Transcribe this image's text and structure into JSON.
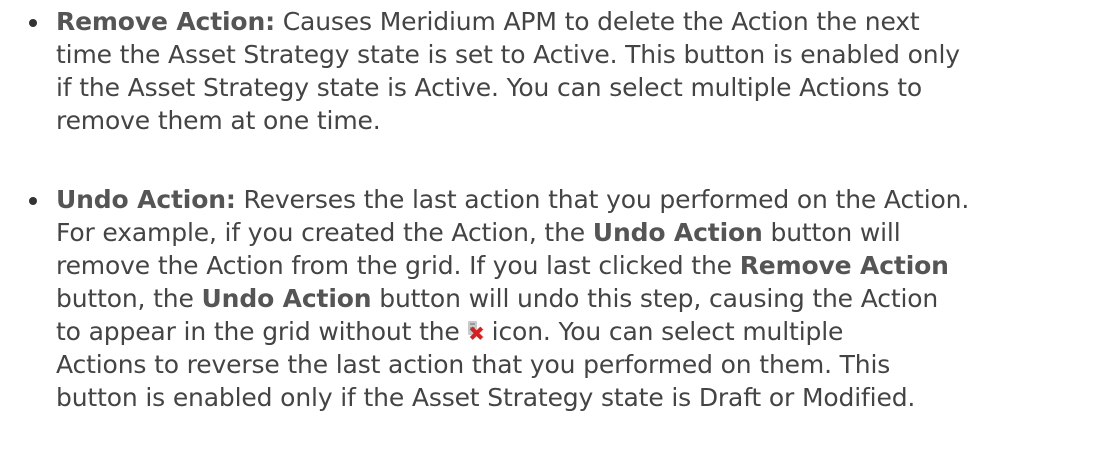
{
  "items": [
    {
      "term": "Remove Action:",
      "lines": [
        " Causes Meridium APM to delete the Action the next",
        "time the Asset Strategy state is set to Active. This button is enabled only",
        "if the Asset Strategy state is Active. You can select multiple Actions to",
        "remove them at one time."
      ]
    },
    {
      "term": "Undo Action:",
      "l1": " Reverses the last action that you performed on the Action.",
      "l2a": "For example, if you created the Action, the ",
      "l2b": "Undo Action",
      "l2c": " button will",
      "l3a": "remove the Action from the grid. If you last clicked the ",
      "l3b": "Remove Action",
      "l4a": "button, the ",
      "l4b": "Undo Action",
      "l4c": " button will undo this step, causing the Action",
      "l5a": "to appear in the grid without the",
      "l5b": "icon. You can select multiple",
      "l6": "Actions to reverse the last action that you performed on them. This",
      "l7": "button is enabled only if the Asset Strategy state is Draft or Modified."
    }
  ],
  "icons": {
    "remove_icon": "remove-action-icon",
    "remove_icon_color": "#d81e1e"
  }
}
